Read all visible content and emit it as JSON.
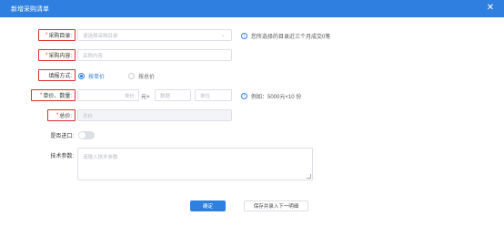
{
  "dialog": {
    "title": "新增采购清单",
    "close_glyph": "✕"
  },
  "form": {
    "catalog": {
      "label": "采购目录:",
      "placeholder": "请选择采购目录",
      "chevron": "⌄",
      "hint": "您所选择的目录近三个月成交0笔",
      "hint_icon": "i"
    },
    "content": {
      "label": "采购内容:",
      "placeholder": "采购内容"
    },
    "fill_method": {
      "label": "填报方式:",
      "options": [
        {
          "label": "按单价",
          "checked": true
        },
        {
          "label": "按总价",
          "checked": false
        }
      ]
    },
    "unit_price": {
      "label": "单价、数量:",
      "price_placeholder": "单价",
      "price_suffix": "元×",
      "qty_placeholder": "数据",
      "unit_placeholder": "单位",
      "hint": "例如：5000元×10 份",
      "hint_icon": "i"
    },
    "total": {
      "label": "总价:",
      "placeholder": "总价"
    },
    "import": {
      "label": "是否进口:"
    },
    "tech": {
      "label": "技术参数:",
      "placeholder": "请输入技术参数"
    }
  },
  "buttons": {
    "confirm": "确定",
    "save_next": "保存并录入下一明细"
  },
  "colors": {
    "accent": "#2f7fe0",
    "highlight_border": "#d93030"
  }
}
